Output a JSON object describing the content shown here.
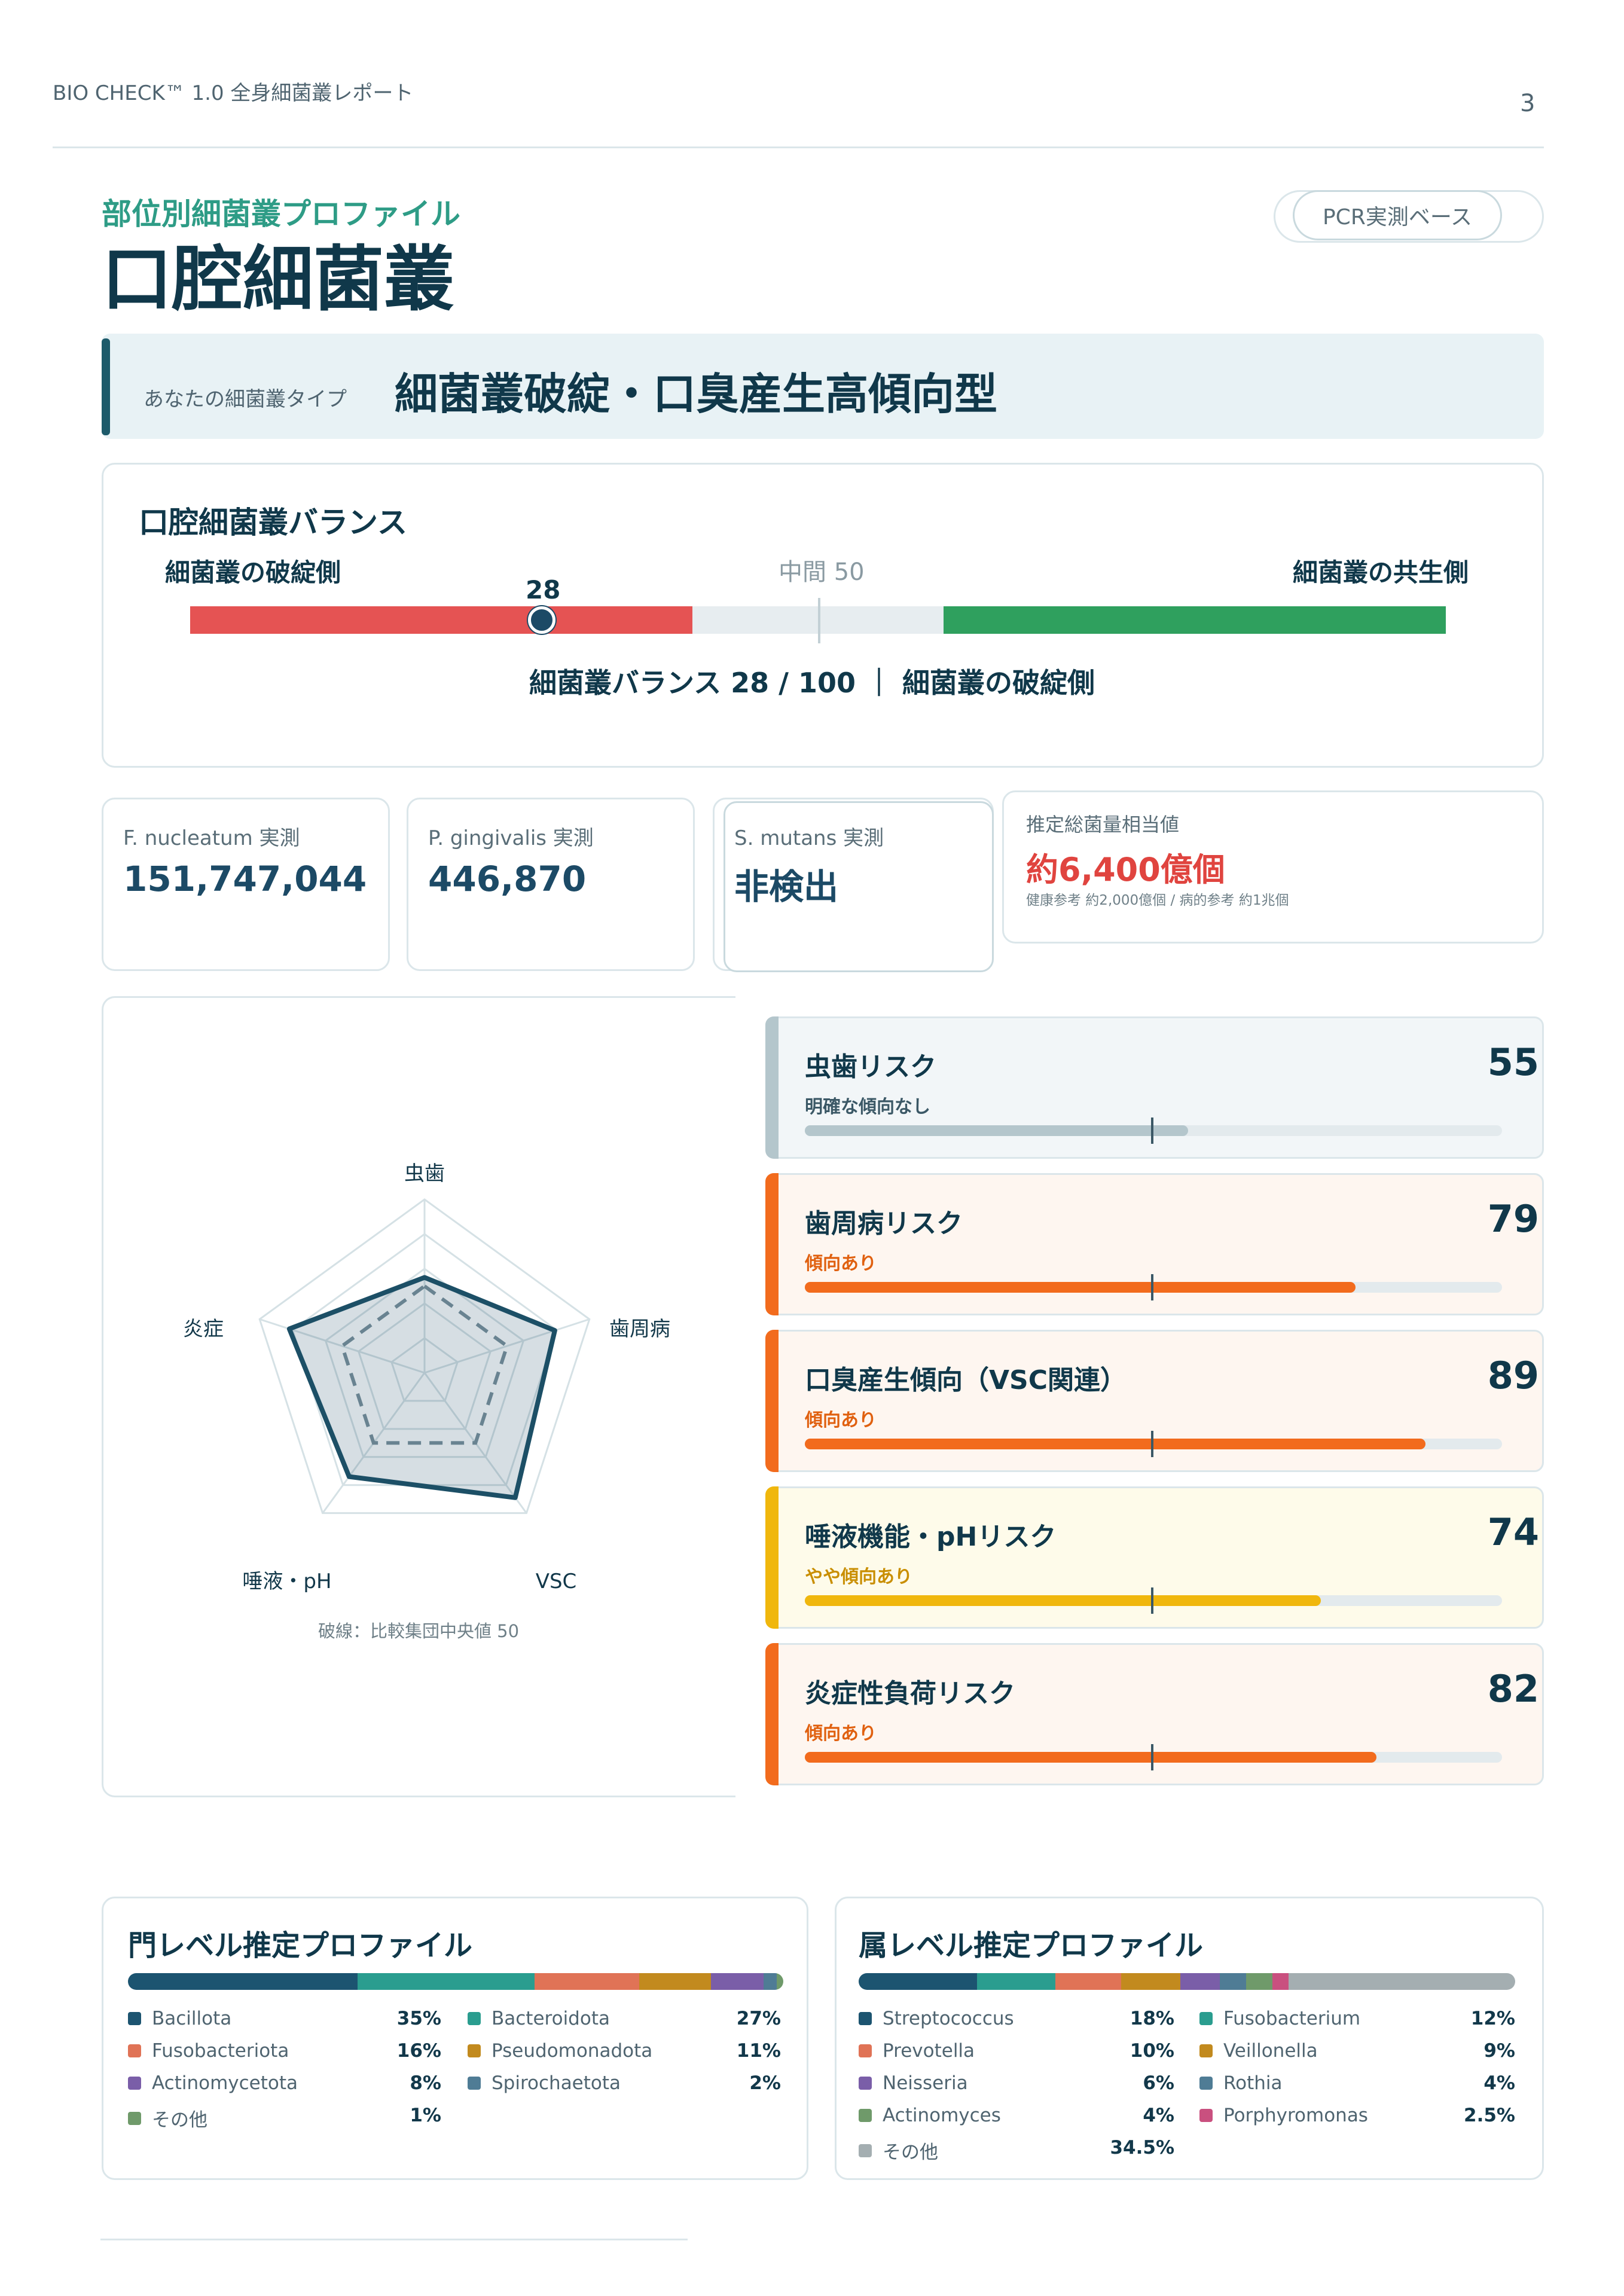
{
  "header": {
    "title": "BIO CHECK™ 1.0 全身細菌叢レポート",
    "page_number": "3"
  },
  "section": {
    "kicker": "部位別細菌叢プロファイル",
    "title": "口腔細菌叢",
    "badge": "PCR実測ベース"
  },
  "type": {
    "label": "あなたの細菌叢タイプ",
    "value": "細菌叢破綻・口臭産生高傾向型"
  },
  "balance": {
    "title": "口腔細菌叢バランス",
    "left_label": "細菌叢の破綻側",
    "mid_label": "中間 50",
    "right_label": "細菌叢の共生側",
    "score": 28,
    "score_text": "28",
    "summary": "細菌叢バランス 28 / 100 ｜ 細菌叢の破綻側",
    "colors": {
      "dysbiosis": "#e55353",
      "neutral": "#e7edf0",
      "symbiosis": "#2fa05e"
    }
  },
  "metrics": [
    {
      "label": "F. nucleatum 実測",
      "value": "151,747,044"
    },
    {
      "label": "P. gingivalis 実測",
      "value": "446,870"
    },
    {
      "label": "S. mutans 実測",
      "value": "非検出"
    }
  ],
  "estimate": {
    "label": "推定総菌量相当値",
    "value": "約6,400億個",
    "note": "健康参考 約2,000億個 / 病的参考 約1兆個"
  },
  "radar": {
    "axes": [
      "虫歯",
      "歯周病",
      "VSC",
      "唾液・pH",
      "炎症"
    ],
    "values": [
      55,
      79,
      89,
      74,
      82
    ],
    "reference": 50,
    "max": 100,
    "note": "破線：比較集団中央値 50"
  },
  "risks": [
    {
      "title": "虫歯リスク",
      "sub": "明確な傾向なし",
      "score": 55,
      "score_text": "55",
      "color": "#b4c6cc",
      "sub_color": "#3b5866",
      "bg": "#f2f6f8"
    },
    {
      "title": "歯周病リスク",
      "sub": "傾向あり",
      "score": 79,
      "score_text": "79",
      "color": "#f26b1d",
      "sub_color": "#e0600f",
      "bg": "#fef6f0"
    },
    {
      "title": "口臭産生傾向（VSC関連）",
      "sub": "傾向あり",
      "score": 89,
      "score_text": "89",
      "color": "#f26b1d",
      "sub_color": "#e0600f",
      "bg": "#fef6f0"
    },
    {
      "title": "唾液機能・pHリスク",
      "sub": "やや傾向あり",
      "score": 74,
      "score_text": "74",
      "color": "#f0b70d",
      "sub_color": "#c98e00",
      "bg": "#fefbea"
    },
    {
      "title": "炎症性負荷リスク",
      "sub": "傾向あり",
      "score": 82,
      "score_text": "82",
      "color": "#f26b1d",
      "sub_color": "#e0600f",
      "bg": "#fef6f0"
    }
  ],
  "phylum": {
    "title": "門レベル推定プロファイル",
    "items": [
      {
        "name": "Bacillota",
        "pct": "35%",
        "value": 35,
        "color": "#1c5470"
      },
      {
        "name": "Bacteroidota",
        "pct": "27%",
        "value": 27,
        "color": "#2a9d8f"
      },
      {
        "name": "Fusobacteriota",
        "pct": "16%",
        "value": 16,
        "color": "#e07356"
      },
      {
        "name": "Pseudomonadota",
        "pct": "11%",
        "value": 11,
        "color": "#c28a1e"
      },
      {
        "name": "Actinomycetota",
        "pct": "8%",
        "value": 8,
        "color": "#7a5ea8"
      },
      {
        "name": "Spirochaetota",
        "pct": "2%",
        "value": 2,
        "color": "#4f7c95"
      },
      {
        "name": "その他",
        "pct": "1%",
        "value": 1,
        "color": "#6f9a6a"
      }
    ]
  },
  "genus": {
    "title": "属レベル推定プロファイル",
    "items": [
      {
        "name": "Streptococcus",
        "pct": "18%",
        "value": 18,
        "color": "#1c5470"
      },
      {
        "name": "Fusobacterium",
        "pct": "12%",
        "value": 12,
        "color": "#2a9d8f"
      },
      {
        "name": "Prevotella",
        "pct": "10%",
        "value": 10,
        "color": "#e07356"
      },
      {
        "name": "Veillonella",
        "pct": "9%",
        "value": 9,
        "color": "#c28a1e"
      },
      {
        "name": "Neisseria",
        "pct": "6%",
        "value": 6,
        "color": "#7a5ea8"
      },
      {
        "name": "Rothia",
        "pct": "4%",
        "value": 4,
        "color": "#4f7c95"
      },
      {
        "name": "Actinomyces",
        "pct": "4%",
        "value": 4,
        "color": "#6f9a6a"
      },
      {
        "name": "Porphyromonas",
        "pct": "2.5%",
        "value": 2.5,
        "color": "#c9507f"
      },
      {
        "name": "その他",
        "pct": "34.5%",
        "value": 34.5,
        "color": "#a4aeb1"
      }
    ]
  }
}
